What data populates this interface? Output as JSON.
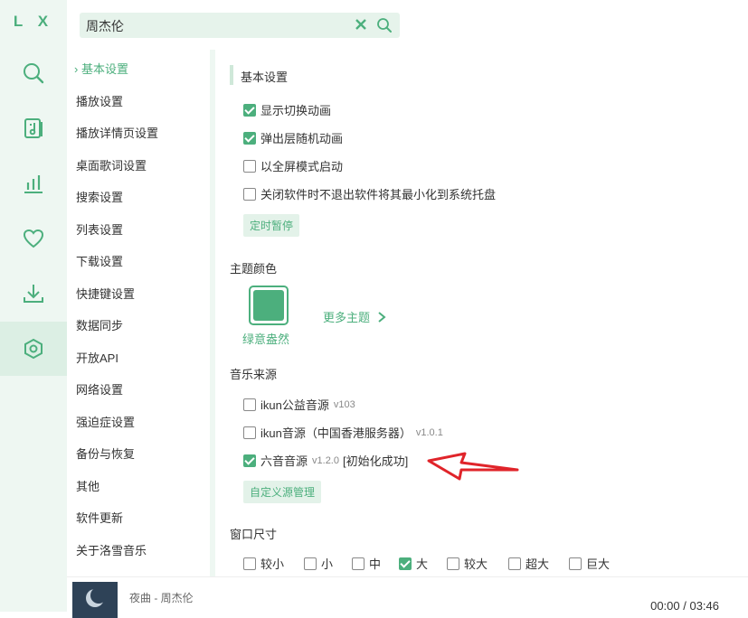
{
  "app": {
    "logo": "L X"
  },
  "sidebar": {
    "nav": [
      {
        "name": "search-icon"
      },
      {
        "name": "music-list-icon"
      },
      {
        "name": "chart-icon"
      },
      {
        "name": "heart-icon"
      },
      {
        "name": "download-icon"
      },
      {
        "name": "settings-icon"
      }
    ]
  },
  "search": {
    "value": "周杰伦"
  },
  "menu": {
    "items": [
      "基本设置",
      "播放设置",
      "播放详情页设置",
      "桌面歌词设置",
      "搜索设置",
      "列表设置",
      "下载设置",
      "快捷键设置",
      "数据同步",
      "开放API",
      "网络设置",
      "强迫症设置",
      "备份与恢复",
      "其他",
      "软件更新",
      "关于洛雪音乐"
    ],
    "active": "基本设置"
  },
  "basic": {
    "title": "基本设置",
    "options": [
      {
        "label": "显示切换动画",
        "checked": true
      },
      {
        "label": "弹出层随机动画",
        "checked": true
      },
      {
        "label": "以全屏模式启动",
        "checked": false
      },
      {
        "label": "关闭软件时不退出软件将其最小化到系统托盘",
        "checked": false
      }
    ],
    "timer_button": "定时暂停"
  },
  "theme": {
    "title": "主题颜色",
    "current": "绿意盎然",
    "more": "更多主题",
    "color": "#4caf7d"
  },
  "source": {
    "title": "音乐来源",
    "items": [
      {
        "label": "ikun公益音源",
        "version": "v103",
        "extra": "",
        "checked": false
      },
      {
        "label": "ikun音源（中国香港服务器）",
        "version": "v1.0.1",
        "extra": "",
        "checked": false
      },
      {
        "label": "六音音源",
        "version": "v1.2.0",
        "extra": "[初始化成功]",
        "checked": true
      }
    ],
    "manage_button": "自定义源管理"
  },
  "window_size": {
    "title": "窗口尺寸",
    "options": [
      {
        "label": "较小",
        "checked": false
      },
      {
        "label": "小",
        "checked": false
      },
      {
        "label": "中",
        "checked": false
      },
      {
        "label": "大",
        "checked": true
      },
      {
        "label": "较大",
        "checked": false
      },
      {
        "label": "超大",
        "checked": false
      },
      {
        "label": "巨大",
        "checked": false
      }
    ]
  },
  "player": {
    "song": "夜曲 - 周杰伦",
    "time": "00:00 / 03:46"
  },
  "colors": {
    "accent": "#4caf7d",
    "sidebar_bg": "#eef7f2",
    "annotation": "#e0242a"
  }
}
